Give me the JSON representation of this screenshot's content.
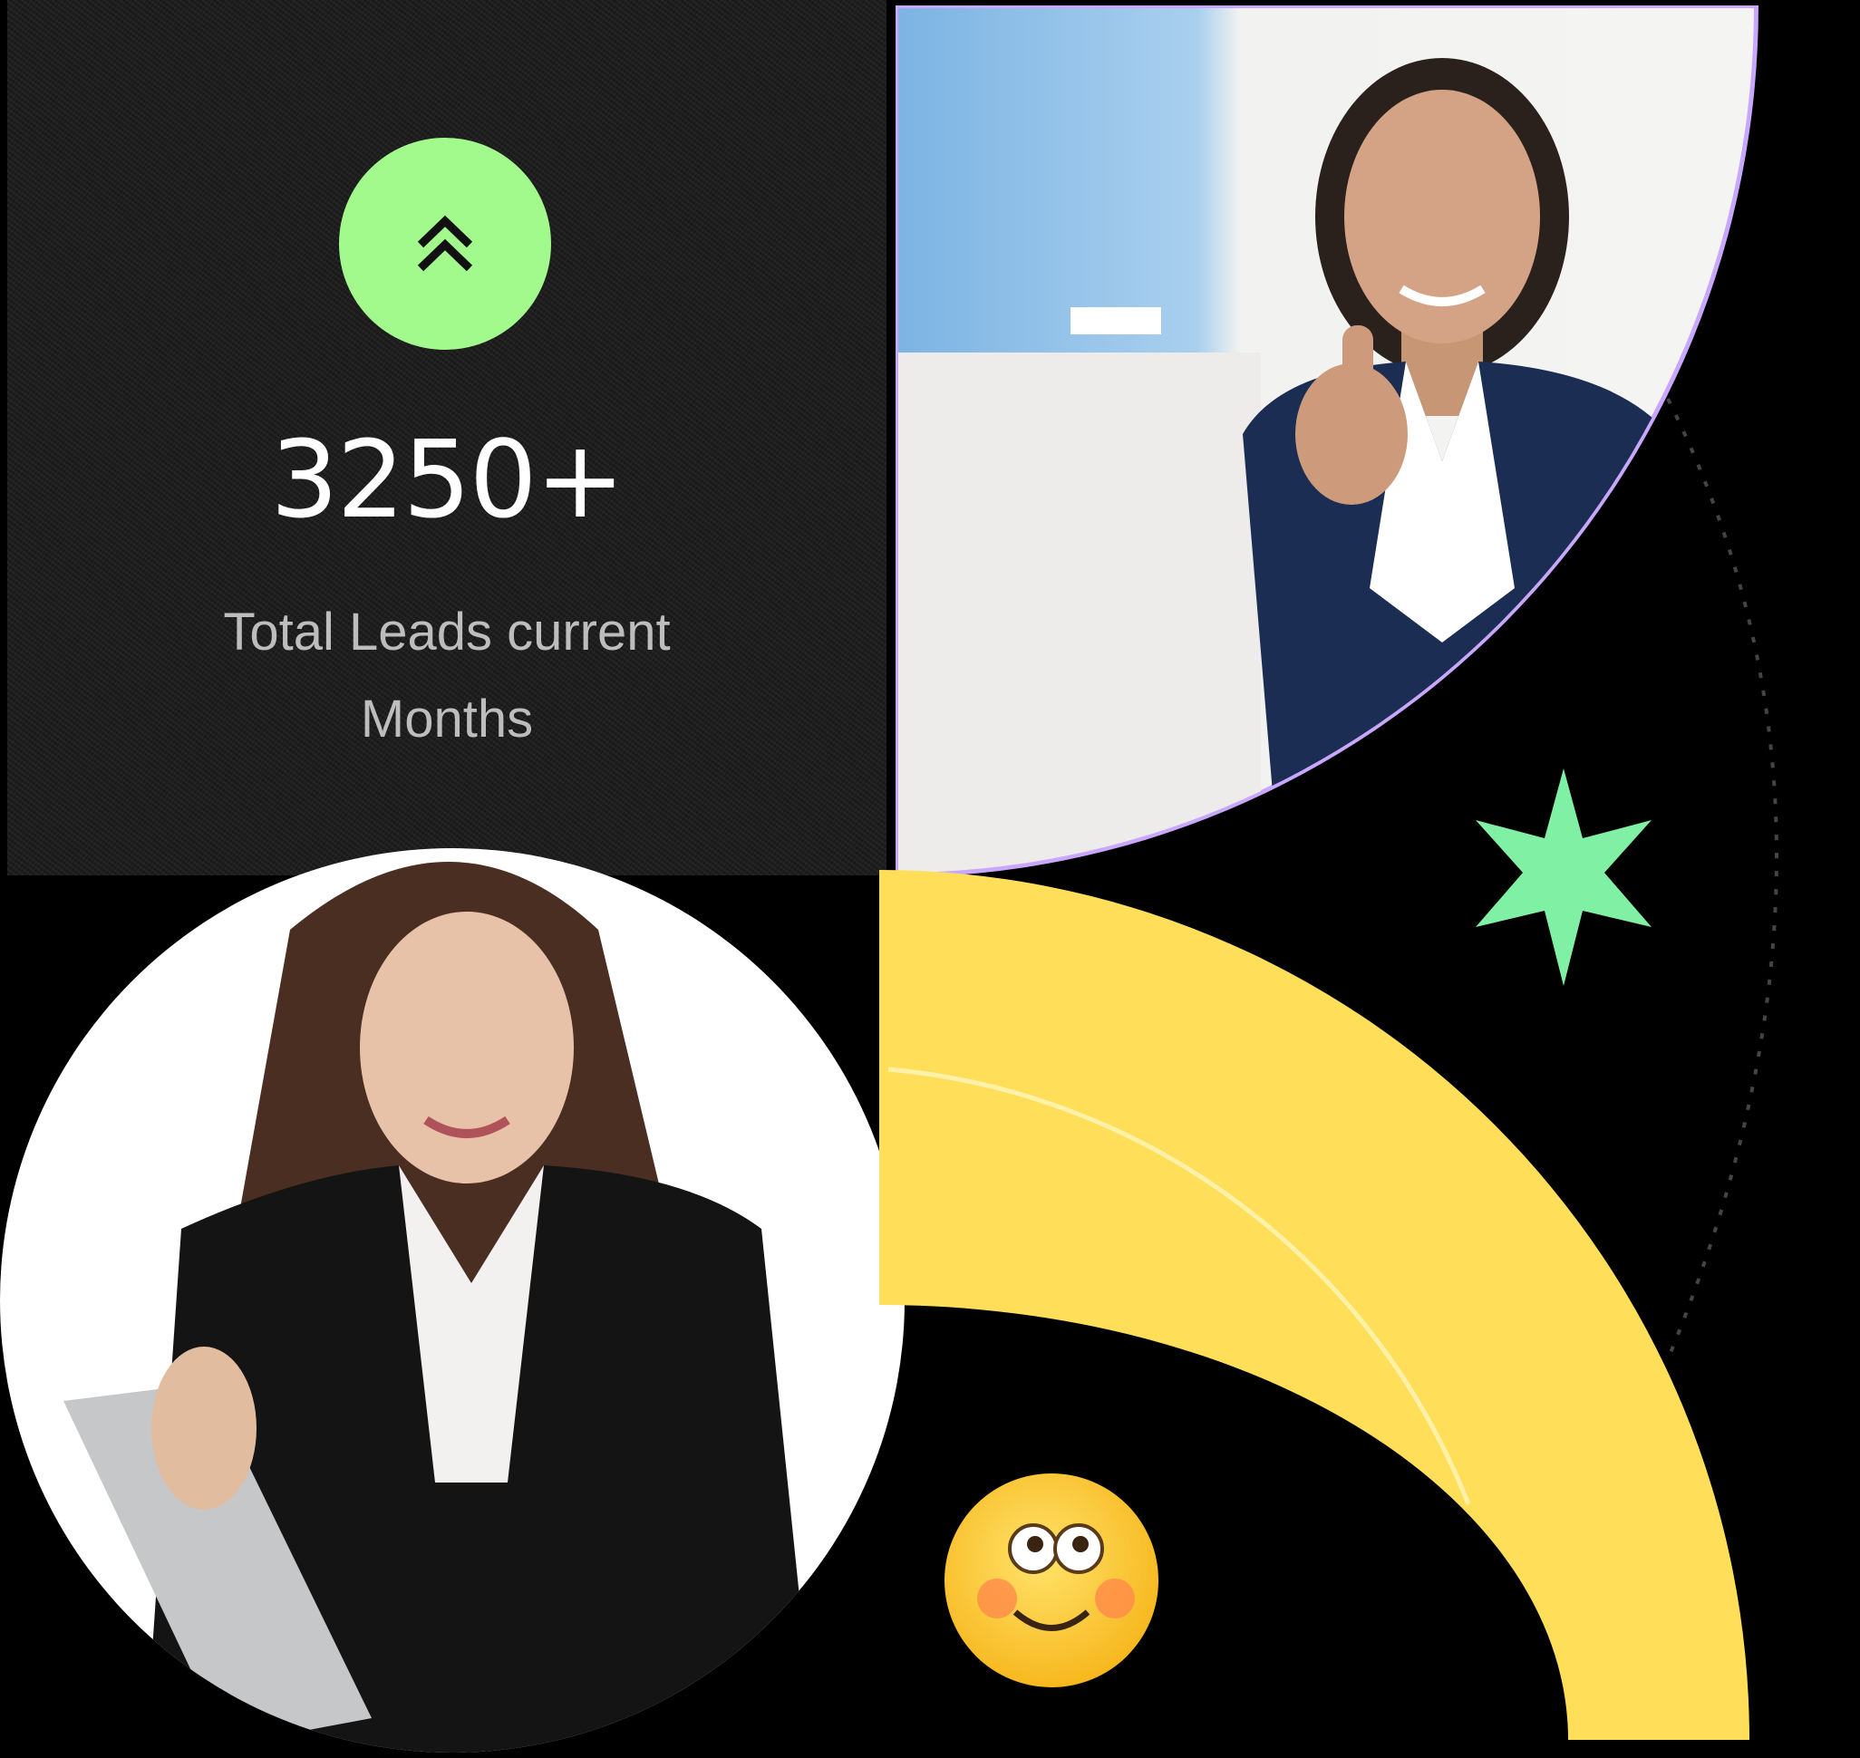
{
  "stats": {
    "value": "3250+",
    "label": "Total Leads current Months",
    "badge_icon": "double-chevron-up-icon",
    "badge_color": "#a3fa8c"
  },
  "colors": {
    "accent_purple": "#c9a7ff",
    "accent_yellow": "#ffde5a",
    "accent_mint": "#7ff0a4",
    "card_bg": "#1d1d1d"
  },
  "images": {
    "top_photo": "businesswoman-pointing-photo",
    "bottom_photo": "businesswoman-with-tablet-photo"
  },
  "decor": {
    "star": "star-icon",
    "emoji": "smiling-emoji-icon"
  }
}
